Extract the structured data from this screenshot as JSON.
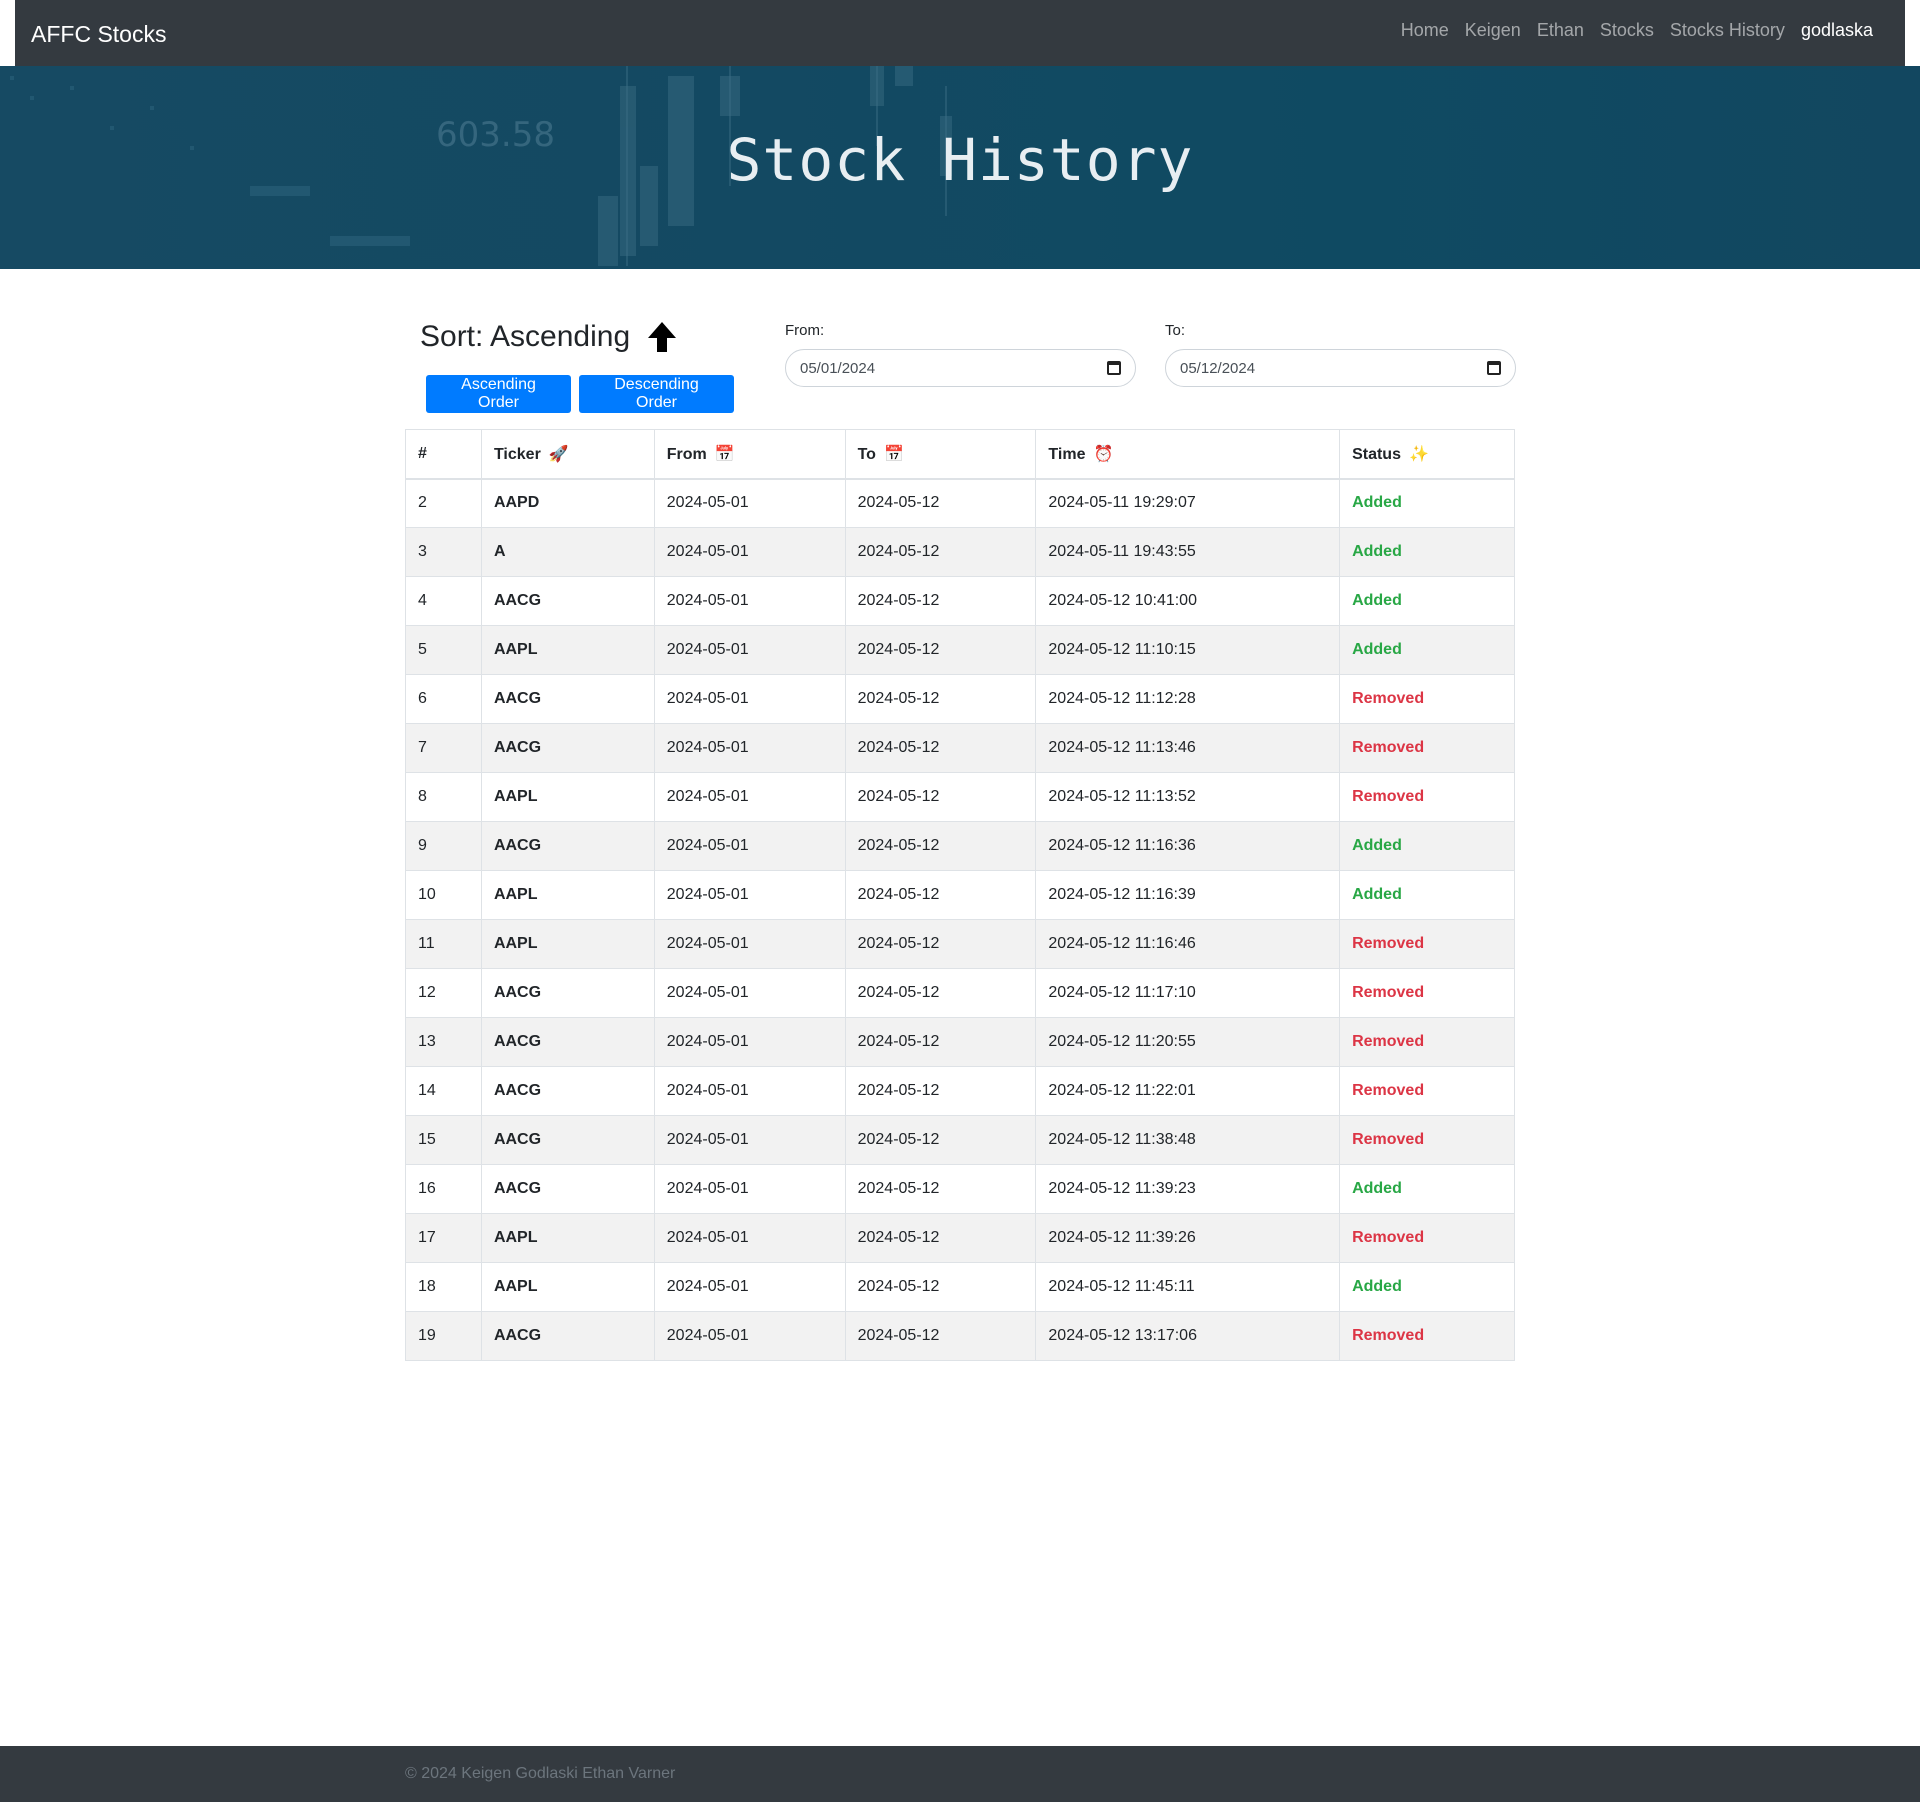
{
  "navbar": {
    "brand": "AFFC Stocks",
    "links": [
      "Home",
      "Keigen",
      "Ethan",
      "Stocks",
      "Stocks History"
    ],
    "user": "godlaska"
  },
  "hero": {
    "title": "Stock History",
    "background_price": "603.58"
  },
  "sort": {
    "title": "Sort: Ascending",
    "ascending_button": "Ascending Order",
    "descending_button": "Descending Order"
  },
  "filters": {
    "from_label": "From:",
    "from_value": "05/01/2024",
    "to_label": "To:",
    "to_value": "05/12/2024"
  },
  "table": {
    "headers": [
      "#",
      "Ticker",
      "From",
      "To",
      "Time",
      "Status"
    ],
    "header_icons": [
      "",
      "rocket-icon",
      "calendar-icon",
      "calendar-icon",
      "alarm-clock-icon",
      "sparkles-icon"
    ],
    "rows": [
      {
        "id": "2",
        "ticker": "AAPD",
        "from": "2024-05-01",
        "to": "2024-05-12",
        "time": "2024-05-11 19:29:07",
        "status": "Added"
      },
      {
        "id": "3",
        "ticker": "A",
        "from": "2024-05-01",
        "to": "2024-05-12",
        "time": "2024-05-11 19:43:55",
        "status": "Added"
      },
      {
        "id": "4",
        "ticker": "AACG",
        "from": "2024-05-01",
        "to": "2024-05-12",
        "time": "2024-05-12 10:41:00",
        "status": "Added"
      },
      {
        "id": "5",
        "ticker": "AAPL",
        "from": "2024-05-01",
        "to": "2024-05-12",
        "time": "2024-05-12 11:10:15",
        "status": "Added"
      },
      {
        "id": "6",
        "ticker": "AACG",
        "from": "2024-05-01",
        "to": "2024-05-12",
        "time": "2024-05-12 11:12:28",
        "status": "Removed"
      },
      {
        "id": "7",
        "ticker": "AACG",
        "from": "2024-05-01",
        "to": "2024-05-12",
        "time": "2024-05-12 11:13:46",
        "status": "Removed"
      },
      {
        "id": "8",
        "ticker": "AAPL",
        "from": "2024-05-01",
        "to": "2024-05-12",
        "time": "2024-05-12 11:13:52",
        "status": "Removed"
      },
      {
        "id": "9",
        "ticker": "AACG",
        "from": "2024-05-01",
        "to": "2024-05-12",
        "time": "2024-05-12 11:16:36",
        "status": "Added"
      },
      {
        "id": "10",
        "ticker": "AAPL",
        "from": "2024-05-01",
        "to": "2024-05-12",
        "time": "2024-05-12 11:16:39",
        "status": "Added"
      },
      {
        "id": "11",
        "ticker": "AAPL",
        "from": "2024-05-01",
        "to": "2024-05-12",
        "time": "2024-05-12 11:16:46",
        "status": "Removed"
      },
      {
        "id": "12",
        "ticker": "AACG",
        "from": "2024-05-01",
        "to": "2024-05-12",
        "time": "2024-05-12 11:17:10",
        "status": "Removed"
      },
      {
        "id": "13",
        "ticker": "AACG",
        "from": "2024-05-01",
        "to": "2024-05-12",
        "time": "2024-05-12 11:20:55",
        "status": "Removed"
      },
      {
        "id": "14",
        "ticker": "AACG",
        "from": "2024-05-01",
        "to": "2024-05-12",
        "time": "2024-05-12 11:22:01",
        "status": "Removed"
      },
      {
        "id": "15",
        "ticker": "AACG",
        "from": "2024-05-01",
        "to": "2024-05-12",
        "time": "2024-05-12 11:38:48",
        "status": "Removed"
      },
      {
        "id": "16",
        "ticker": "AACG",
        "from": "2024-05-01",
        "to": "2024-05-12",
        "time": "2024-05-12 11:39:23",
        "status": "Added"
      },
      {
        "id": "17",
        "ticker": "AAPL",
        "from": "2024-05-01",
        "to": "2024-05-12",
        "time": "2024-05-12 11:39:26",
        "status": "Removed"
      },
      {
        "id": "18",
        "ticker": "AAPL",
        "from": "2024-05-01",
        "to": "2024-05-12",
        "time": "2024-05-12 11:45:11",
        "status": "Added"
      },
      {
        "id": "19",
        "ticker": "AACG",
        "from": "2024-05-01",
        "to": "2024-05-12",
        "time": "2024-05-12 13:17:06",
        "status": "Removed"
      }
    ]
  },
  "footer": {
    "text": "© 2024 Keigen Godlaski Ethan Varner"
  },
  "colors": {
    "navbar": "#343a40",
    "primary": "#007bff",
    "added": "#28a745",
    "removed": "#dc3545",
    "hero": "#134962"
  }
}
